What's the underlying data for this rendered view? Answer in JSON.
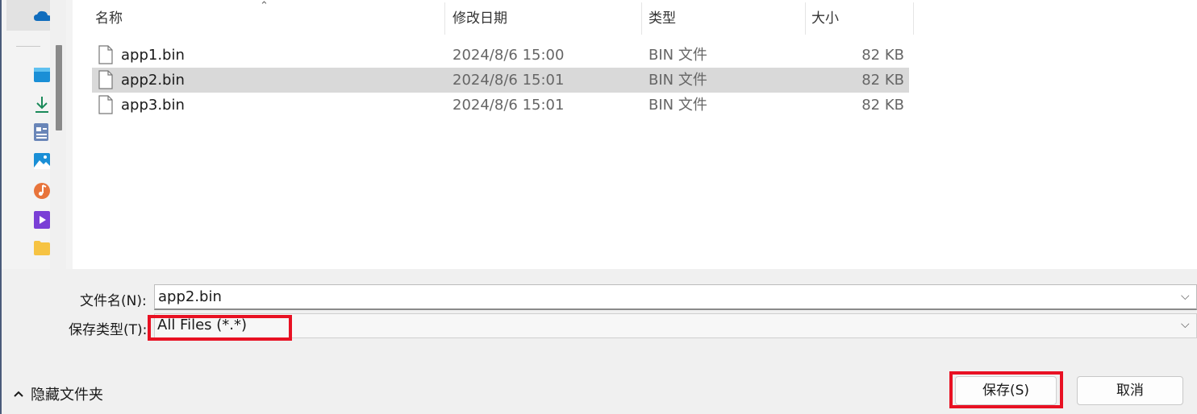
{
  "columns": {
    "name": "名称",
    "date": "修改日期",
    "type": "类型",
    "size": "大小"
  },
  "files": [
    {
      "name": "app1.bin",
      "date": "2024/8/6 15:00",
      "type": "BIN 文件",
      "size": "82 KB",
      "selected": false
    },
    {
      "name": "app2.bin",
      "date": "2024/8/6 15:01",
      "type": "BIN 文件",
      "size": "82 KB",
      "selected": true
    },
    {
      "name": "app3.bin",
      "date": "2024/8/6 15:01",
      "type": "BIN 文件",
      "size": "82 KB",
      "selected": false
    }
  ],
  "form": {
    "filename_label": "文件名(N):",
    "filename_value": "app2.bin",
    "filetype_label": "保存类型(T):",
    "filetype_value": "All Files (*.*)"
  },
  "footer": {
    "hide_folders_label": "隐藏文件夹",
    "save_label": "保存(S)",
    "cancel_label": "取消"
  },
  "nav_icons": [
    "onedrive-icon",
    "desktop-icon",
    "downloads-icon",
    "documents-icon",
    "pictures-icon",
    "music-icon",
    "videos-icon",
    "folder-icon"
  ],
  "colors": {
    "highlight_box": "#e81123",
    "selected_row": "#d9d9d9"
  }
}
